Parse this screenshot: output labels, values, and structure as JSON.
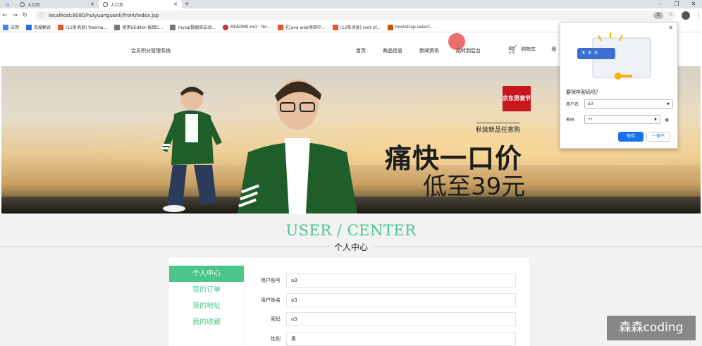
{
  "browser": {
    "tabs": [
      {
        "label": "入口页"
      },
      {
        "label": "入口页"
      }
    ],
    "url": "localhost:8080/huiyuanguanli/front/index.jsp",
    "window_controls": [
      "–",
      "❐",
      "✕"
    ],
    "bookmarks": [
      {
        "label": "应用",
        "color": "#4285f4"
      },
      {
        "label": "百度翻译",
        "color": "#2d6be0"
      },
      {
        "label": "(12条消息) freema...",
        "color": "#e8552d"
      },
      {
        "label": "使用UEditor 报错C...",
        "color": "#777777"
      },
      {
        "label": "mysql数据库启动...",
        "color": "#777777"
      },
      {
        "label": "README.md · Ter...",
        "color": "#c0392b"
      },
      {
        "label": "在java web项目中...",
        "color": "#e8552d"
      },
      {
        "label": "(12条消息) root of...",
        "color": "#e8552d"
      },
      {
        "label": "bootstrap-select...",
        "color": "#d35400"
      }
    ]
  },
  "header": {
    "site_title": "会员积分管理系统",
    "nav": [
      "首页",
      "商品信息",
      "新闻资讯",
      "跳转到后台"
    ],
    "cart_label": "购物车",
    "nav_partial": "我"
  },
  "banner": {
    "brand_badge": "京东男装节",
    "tagline": "秋装新品任意购",
    "headline": "痛快一口价",
    "price_line": "低至39元"
  },
  "password_dialog": {
    "title": "要保存密码吗？",
    "username_label": "用户名",
    "username_value": "a3",
    "password_label": "密码",
    "password_value": "••",
    "save_button": "保存",
    "never_button": "一律不",
    "art_text": "* * *"
  },
  "user_center": {
    "title": "USER / CENTER",
    "subtitle": "个人中心",
    "menu": [
      "个人中心",
      "我的订单",
      "我的地址",
      "我的收藏"
    ],
    "active_menu_index": 0,
    "form": [
      {
        "label": "用户账号",
        "value": "a3"
      },
      {
        "label": "用户姓名",
        "value": "a3"
      },
      {
        "label": "密码",
        "value": "a3"
      },
      {
        "label": "性别",
        "value": "男"
      }
    ]
  },
  "watermark": "森森coding",
  "colors": {
    "accent_green": "#4cc58a",
    "chrome_blue": "#1a73e8",
    "badge_red": "#c8161d"
  }
}
